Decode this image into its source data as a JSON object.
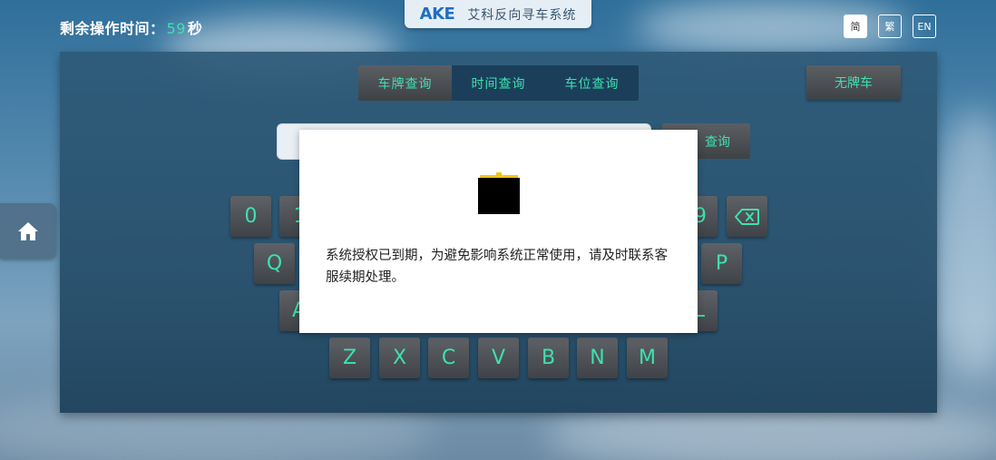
{
  "timer": {
    "label": "剩余操作时间：",
    "seconds": "59",
    "unit": "秒"
  },
  "brand": {
    "logo": "AKE",
    "name": "艾科反向寻车系统"
  },
  "languages": [
    {
      "label": "简",
      "active": true
    },
    {
      "label": "繁",
      "active": false
    },
    {
      "label": "EN",
      "active": false
    }
  ],
  "tabs": [
    {
      "label": "车牌查询",
      "active": true
    },
    {
      "label": "时间查询",
      "active": false
    },
    {
      "label": "车位查询",
      "active": false
    }
  ],
  "no_plate_button": "无牌车",
  "search": {
    "button_label": "查询",
    "value": ""
  },
  "keyboard": {
    "row1_visible": [
      "0",
      "1",
      "9"
    ],
    "row2_visible": [
      "Q",
      "P"
    ],
    "row3_visible": [
      "A",
      "L"
    ],
    "row4": [
      "Z",
      "X",
      "C",
      "V",
      "B",
      "N",
      "M"
    ]
  },
  "modal": {
    "message": "系统授权已到期，为避免影响系统正常使用，请及时联系客服续期处理。"
  },
  "colors": {
    "accent": "#3ee0b0",
    "panel": "#2e5a78",
    "key": "#4a4e52"
  }
}
